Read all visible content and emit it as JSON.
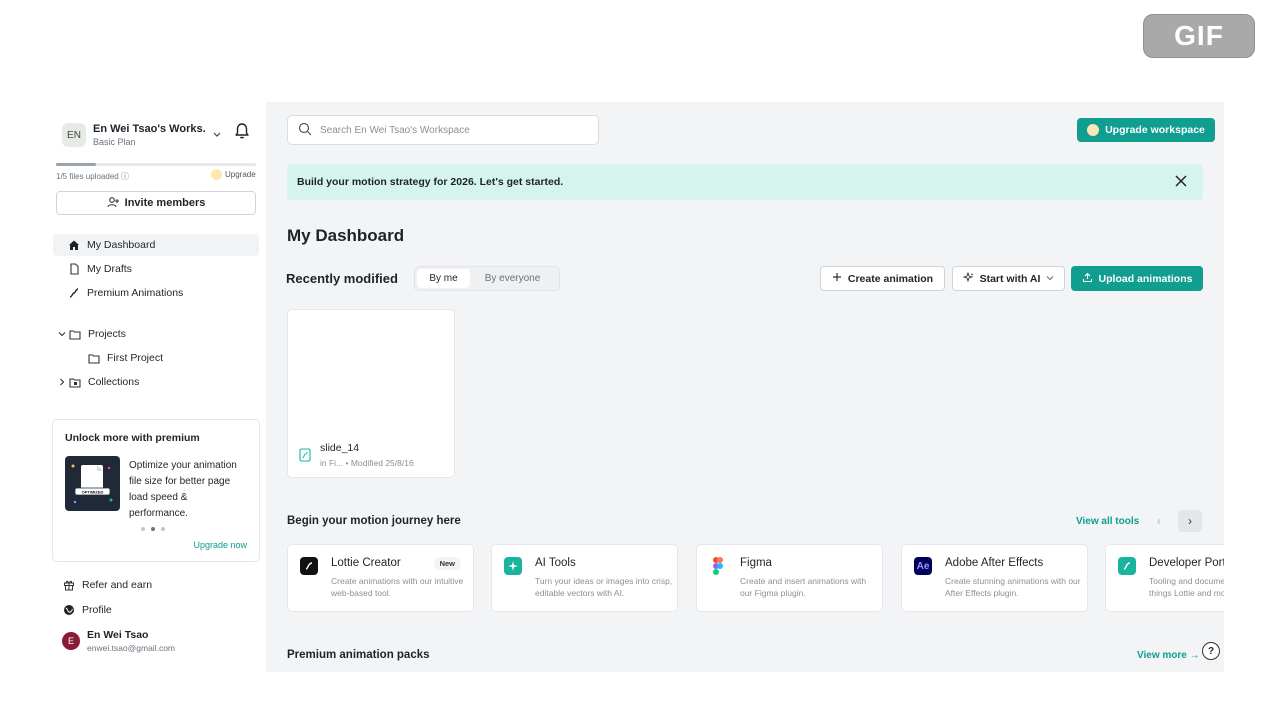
{
  "badge": "GIF",
  "workspace": {
    "initials": "EN",
    "name": "En Wei Tsao's Works...",
    "plan": "Basic Plan",
    "usage_text": "1/5 files uploaded",
    "usage_fraction": 0.2,
    "upgrade_label": "Upgrade"
  },
  "invite_label": "Invite members",
  "nav": {
    "dashboard": "My Dashboard",
    "drafts": "My Drafts",
    "premium": "Premium Animations",
    "projects": "Projects",
    "first_project": "First Project",
    "collections": "Collections"
  },
  "premium_card": {
    "title": "Unlock more with premium",
    "thumb_label": "OPTIMIZED",
    "description": "Optimize your animation file size for better page load speed & performance.",
    "cta": "Upgrade now"
  },
  "footer": {
    "refer": "Refer and earn",
    "profile": "Profile",
    "user_initial": "E",
    "user_name": "En Wei Tsao",
    "user_email": "enwei.tsao@gmail.com"
  },
  "search_placeholder": "Search En Wei Tsao's Workspace",
  "upgrade_workspace": "Upgrade workspace",
  "banner_text": "Build your motion strategy for 2026. Let's get started.",
  "page_title": "My Dashboard",
  "recent": {
    "label": "Recently modified",
    "by_me": "By me",
    "by_everyone": "By everyone",
    "create": "Create animation",
    "start_ai": "Start with AI",
    "upload": "Upload animations"
  },
  "file": {
    "name": "slide_14",
    "meta": "in Fi...  • Modified 25/8/16"
  },
  "journey": {
    "title": "Begin your motion journey here",
    "view_all": "View all tools",
    "tools": [
      {
        "name": "Lottie Creator",
        "badge": "New",
        "desc": "Create animations with our intuitive web-based tool.",
        "color": "#111111"
      },
      {
        "name": "AI Tools",
        "desc": "Turn your ideas or images into crisp, editable vectors with AI.",
        "color": "#19b39e"
      },
      {
        "name": "Figma",
        "desc": "Create and insert animations with our Figma plugin.",
        "color": "#ffffff"
      },
      {
        "name": "Adobe After Effects",
        "desc": "Create stunning animations with our After Effects plugin.",
        "color": "#00005b"
      },
      {
        "name": "Developer Portal",
        "desc": "Tooling and documentation for all things Lottie and more.",
        "color": "#19b39e"
      }
    ]
  },
  "packs": {
    "title": "Premium animation packs",
    "view_more": "View more"
  }
}
